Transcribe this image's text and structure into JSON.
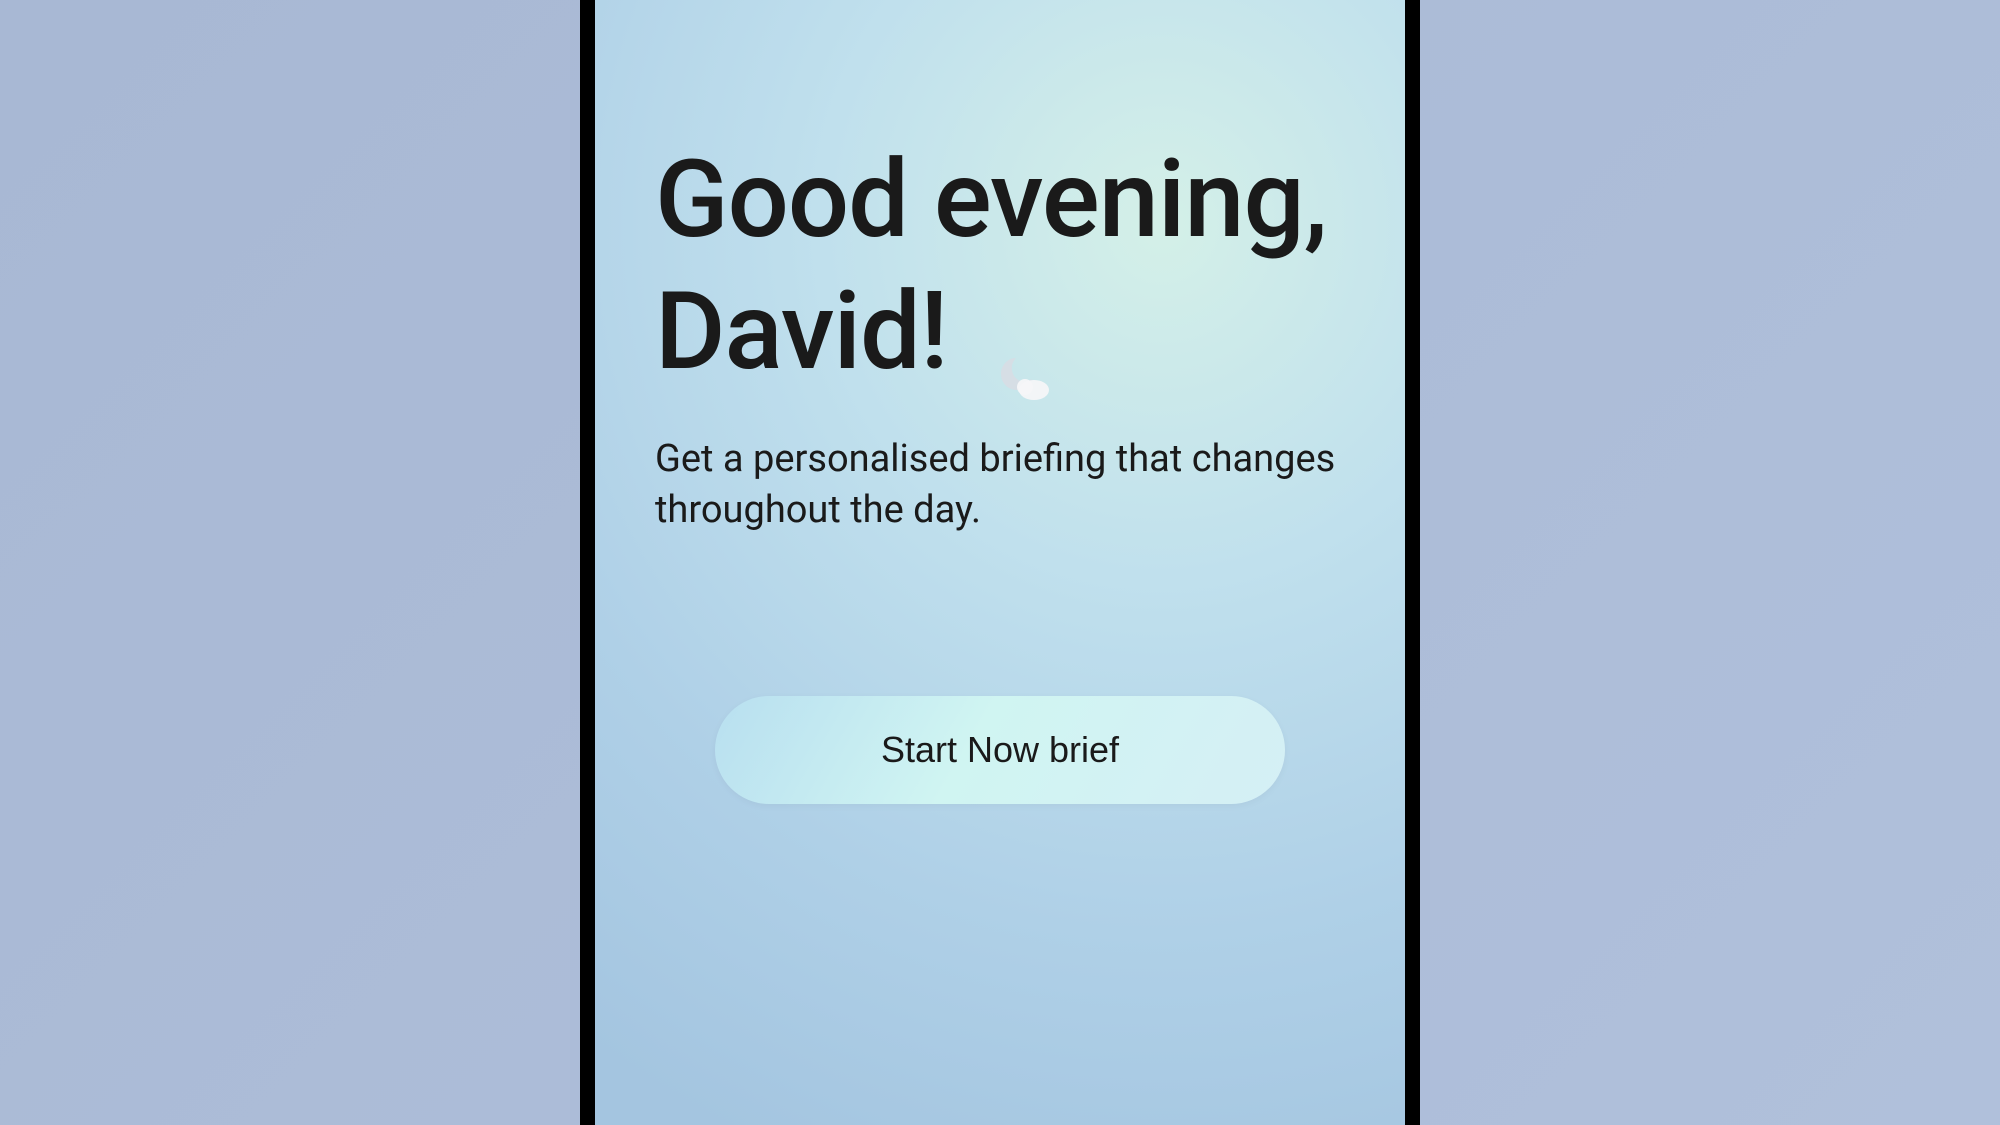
{
  "greeting": {
    "heading": "Good evening, David!",
    "subtitle": "Get a personalised briefing that changes throughout the day."
  },
  "button": {
    "start_label": "Start Now brief"
  },
  "icon": {
    "name": "moon-night-icon"
  }
}
